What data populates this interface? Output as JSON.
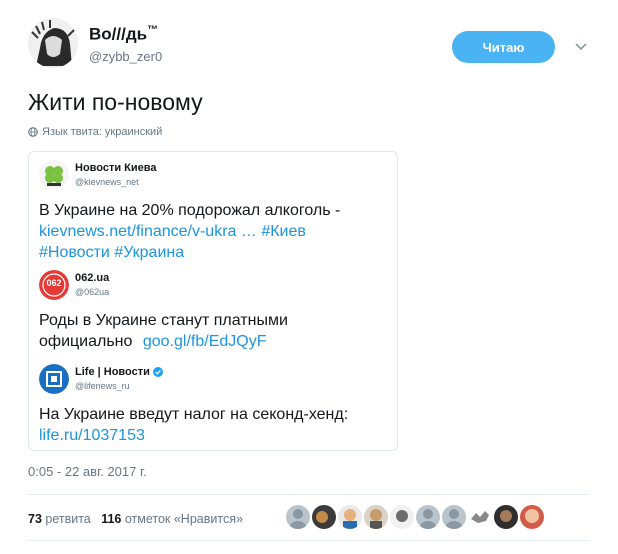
{
  "author": {
    "display_name": "Во///дь",
    "tm": "™",
    "handle": "@zybb_zer0"
  },
  "follow_button": "Читаю",
  "tweet": {
    "text": "Жити по-новому",
    "language_note": "Язык твита: украинский"
  },
  "embedded": [
    {
      "name": "Новости Киева",
      "handle": "@kievnews_net",
      "avatar_color": "#7cc241",
      "text_plain": "В Украине на 20% подорожал алкоголь -",
      "link": "kievnews.net/finance/v-ukra …",
      "tag1": "#Киев",
      "tag2": "#Новости",
      "tag3": "#Украина"
    },
    {
      "name": "062.ua",
      "handle": "@062ua",
      "avatar_color": "#e53935",
      "avatar_label": "062",
      "text_line1": "Роды в Украине станут платными",
      "text_line2": "официально",
      "link": "goo.gl/fb/EdJQyF"
    },
    {
      "name": "Life | Новости",
      "handle": "@lifenews_ru",
      "avatar_color": "#1a6fc2",
      "text_line1": "На Украине введут налог на секонд-хенд:",
      "link": "life.ru/1037153"
    }
  ],
  "timestamp": "0:05 - 22 авг. 2017 г.",
  "stats": {
    "retweets_count": "73",
    "retweets_label": "ретвита",
    "likes_count": "116",
    "likes_label": "отметок «Нравится»"
  },
  "colors": {
    "accent": "#1b95e0",
    "follow_bg": "#4ab3f4",
    "muted": "#657786"
  }
}
